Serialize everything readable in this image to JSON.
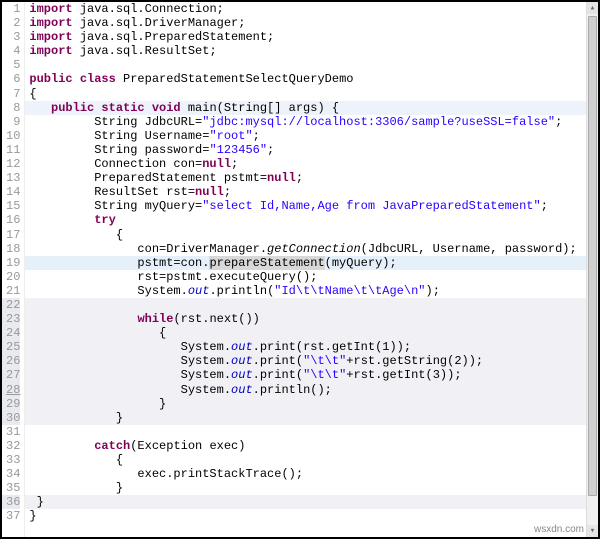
{
  "watermark": "wsxdn.com",
  "lines": [
    {
      "n": 1,
      "flags": "",
      "tokens": [
        [
          "kw",
          "import"
        ],
        [
          "",
          " java.sql.Connection;"
        ]
      ]
    },
    {
      "n": 2,
      "flags": "",
      "tokens": [
        [
          "kw",
          "import"
        ],
        [
          "",
          " java.sql.DriverManager;"
        ]
      ]
    },
    {
      "n": 3,
      "flags": "",
      "tokens": [
        [
          "kw",
          "import"
        ],
        [
          "",
          " java.sql.PreparedStatement;"
        ]
      ]
    },
    {
      "n": 4,
      "flags": "",
      "tokens": [
        [
          "kw",
          "import"
        ],
        [
          "",
          " java.sql.ResultSet;"
        ]
      ]
    },
    {
      "n": 5,
      "flags": "",
      "tokens": []
    },
    {
      "n": 6,
      "flags": "",
      "tokens": [
        [
          "kw",
          "public class"
        ],
        [
          "",
          " PreparedStatementSelectQueryDemo"
        ]
      ]
    },
    {
      "n": 7,
      "flags": "",
      "tokens": [
        [
          "",
          "{"
        ]
      ]
    },
    {
      "n": 8,
      "flags": "sel",
      "tokens": [
        [
          "",
          "   "
        ],
        [
          "kw",
          "public static void"
        ],
        [
          "",
          " main(String[] args) {"
        ]
      ]
    },
    {
      "n": 9,
      "flags": "",
      "tokens": [
        [
          "",
          "         String JdbcURL="
        ],
        [
          "str",
          "\"jdbc:mysql://localhost:3306/sample?useSSL=false\""
        ],
        [
          "",
          ";"
        ]
      ]
    },
    {
      "n": 10,
      "flags": "",
      "tokens": [
        [
          "",
          "         String Username="
        ],
        [
          "str",
          "\"root\""
        ],
        [
          "",
          ";"
        ]
      ]
    },
    {
      "n": 11,
      "flags": "",
      "tokens": [
        [
          "",
          "         String password="
        ],
        [
          "str",
          "\"123456\""
        ],
        [
          "",
          ";"
        ]
      ]
    },
    {
      "n": 12,
      "flags": "",
      "tokens": [
        [
          "",
          "         Connection con="
        ],
        [
          "kw",
          "null"
        ],
        [
          "",
          ";"
        ]
      ]
    },
    {
      "n": 13,
      "flags": "",
      "tokens": [
        [
          "",
          "         PreparedStatement pstmt="
        ],
        [
          "kw",
          "null"
        ],
        [
          "",
          ";"
        ]
      ]
    },
    {
      "n": 14,
      "flags": "",
      "tokens": [
        [
          "",
          "         ResultSet rst="
        ],
        [
          "kw",
          "null"
        ],
        [
          "",
          ";"
        ]
      ]
    },
    {
      "n": 15,
      "flags": "",
      "tokens": [
        [
          "",
          "         String myQuery="
        ],
        [
          "str",
          "\"select Id,Name,Age from JavaPreparedStatement\""
        ],
        [
          "",
          ";"
        ]
      ]
    },
    {
      "n": 16,
      "flags": "",
      "tokens": [
        [
          "",
          "         "
        ],
        [
          "kw",
          "try"
        ]
      ]
    },
    {
      "n": 17,
      "flags": "",
      "tokens": [
        [
          "",
          "            {"
        ]
      ]
    },
    {
      "n": 18,
      "flags": "",
      "tokens": [
        [
          "",
          "               con=DriverManager."
        ],
        [
          "stat",
          "getConnection"
        ],
        [
          "",
          "(JdbcURL, Username, password);"
        ]
      ]
    },
    {
      "n": 19,
      "flags": "hl",
      "tokens": [
        [
          "",
          "               pstmt=con."
        ],
        [
          "bg-hl",
          "prepareStatement"
        ],
        [
          "",
          "(myQuery);"
        ]
      ]
    },
    {
      "n": 20,
      "flags": "",
      "tokens": [
        [
          "",
          "               rst=pstmt.executeQuery();"
        ]
      ]
    },
    {
      "n": 21,
      "flags": "",
      "tokens": [
        [
          "",
          "               System."
        ],
        [
          "fld",
          "out"
        ],
        [
          "",
          ".println("
        ],
        [
          "str",
          "\"Id\\t\\tName\\t\\tAge\\n\""
        ],
        [
          "",
          ");"
        ]
      ]
    },
    {
      "n": 22,
      "flags": "dim",
      "tokens": []
    },
    {
      "n": 23,
      "flags": "dim",
      "tokens": [
        [
          "",
          "               "
        ],
        [
          "kw",
          "while"
        ],
        [
          "",
          "(rst.next())"
        ]
      ]
    },
    {
      "n": 24,
      "flags": "dim",
      "tokens": [
        [
          "",
          "                  {"
        ]
      ]
    },
    {
      "n": 25,
      "flags": "dim",
      "tokens": [
        [
          "",
          "                     System."
        ],
        [
          "fld",
          "out"
        ],
        [
          "",
          ".print(rst.getInt(1));"
        ]
      ]
    },
    {
      "n": 26,
      "flags": "dim",
      "tokens": [
        [
          "",
          "                     System."
        ],
        [
          "fld",
          "out"
        ],
        [
          "",
          ".print("
        ],
        [
          "str",
          "\"\\t\\t\""
        ],
        [
          "",
          "+rst.getString(2));"
        ]
      ]
    },
    {
      "n": 27,
      "flags": "dim",
      "tokens": [
        [
          "",
          "                     System."
        ],
        [
          "fld",
          "out"
        ],
        [
          "",
          ".print("
        ],
        [
          "str",
          "\"\\t\\t\""
        ],
        [
          "",
          "+rst.getInt(3));"
        ]
      ]
    },
    {
      "n": 28,
      "flags": "dim uline",
      "tokens": [
        [
          "",
          "                     System."
        ],
        [
          "fld",
          "out"
        ],
        [
          "",
          ".println();"
        ]
      ]
    },
    {
      "n": 29,
      "flags": "dim",
      "tokens": [
        [
          "",
          "                  }"
        ]
      ]
    },
    {
      "n": 30,
      "flags": "dim",
      "tokens": [
        [
          "",
          "            }"
        ]
      ]
    },
    {
      "n": 31,
      "flags": "",
      "tokens": []
    },
    {
      "n": 32,
      "flags": "",
      "tokens": [
        [
          "",
          "         "
        ],
        [
          "kw",
          "catch"
        ],
        [
          "",
          "(Exception exec)"
        ]
      ]
    },
    {
      "n": 33,
      "flags": "",
      "tokens": [
        [
          "",
          "            {"
        ]
      ]
    },
    {
      "n": 34,
      "flags": "",
      "tokens": [
        [
          "",
          "               exec.printStackTrace();"
        ]
      ]
    },
    {
      "n": 35,
      "flags": "",
      "tokens": [
        [
          "",
          "            }"
        ]
      ]
    },
    {
      "n": 36,
      "flags": "dim",
      "tokens": [
        [
          "",
          " }"
        ]
      ]
    },
    {
      "n": 37,
      "flags": "",
      "tokens": [
        [
          "",
          "}"
        ]
      ]
    }
  ]
}
